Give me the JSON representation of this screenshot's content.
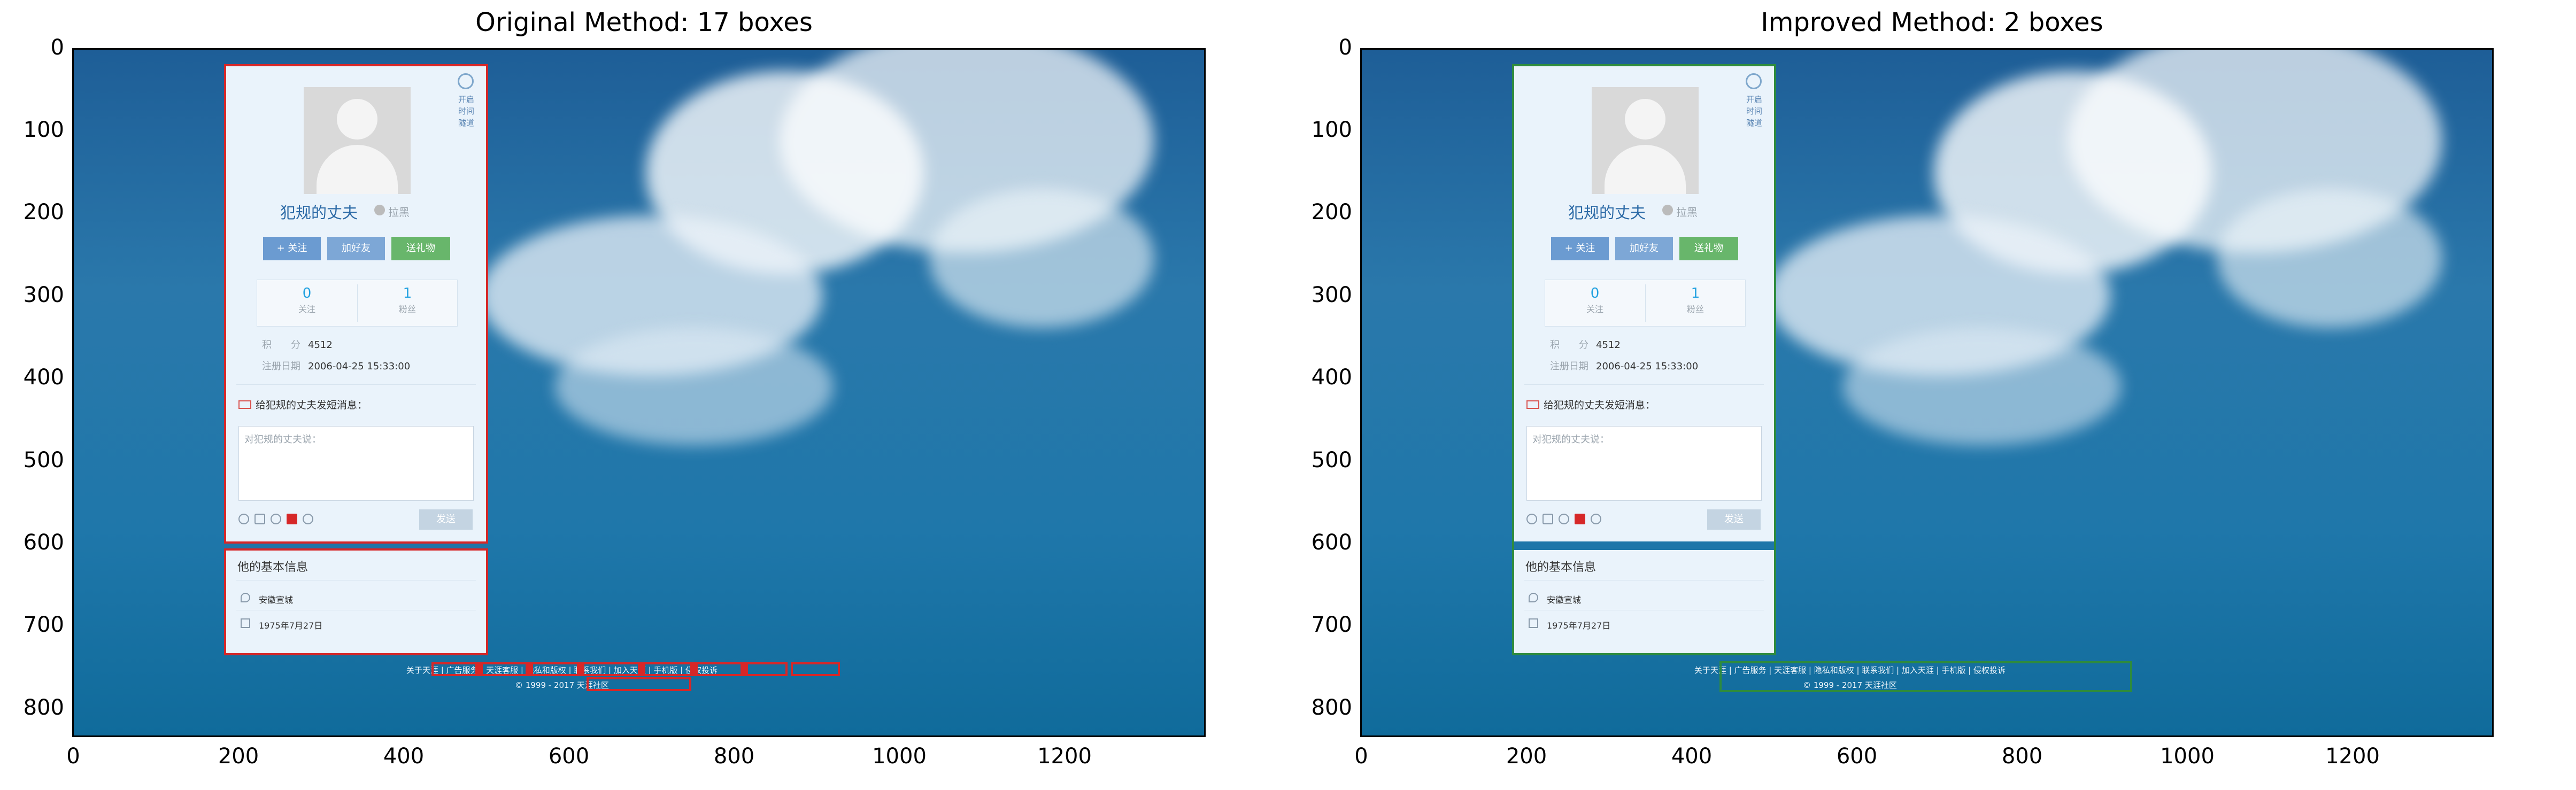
{
  "panels": [
    {
      "title": "Original Method: 17 boxes",
      "box_color": "#d62728",
      "box_count": 17
    },
    {
      "title": "Improved Method: 2 boxes",
      "box_color": "#2e8b3e",
      "box_count": 2
    }
  ],
  "axes": {
    "x_ticks": [
      "0",
      "200",
      "400",
      "600",
      "800",
      "1000",
      "1200"
    ],
    "y_ticks": [
      "0",
      "100",
      "200",
      "300",
      "400",
      "500",
      "600",
      "700",
      "800"
    ]
  },
  "screenshot": {
    "clock_text": "开启\n时间\n隧道",
    "user_name": "犯规的丈夫",
    "block_label": "拉黑",
    "buttons": {
      "follow": "+ 关注",
      "add_friend": "加好友",
      "send_gift": "送礼物"
    },
    "stats": [
      {
        "value": "0",
        "label": "关注"
      },
      {
        "value": "1",
        "label": "粉丝"
      }
    ],
    "meta": [
      {
        "label": "积　　分",
        "value": "4512"
      },
      {
        "label": "注册日期",
        "value": "2006-04-25 15:33:00"
      }
    ],
    "message_title": "给犯规的丈夫发短消息：",
    "message_placeholder": "对犯规的丈夫说：",
    "send_label": "发送",
    "info_title": "他的基本信息",
    "info_location": "安徽宣城",
    "info_birthday": "1975年7月27日",
    "footer_links": "关于天涯 | 广告服务 | 天涯客服 | 隐私和版权 | 联系我们 | 加入天涯 | 手机版 | 侵权投诉",
    "footer_copy": "© 1999 - 2017 天涯社区"
  }
}
